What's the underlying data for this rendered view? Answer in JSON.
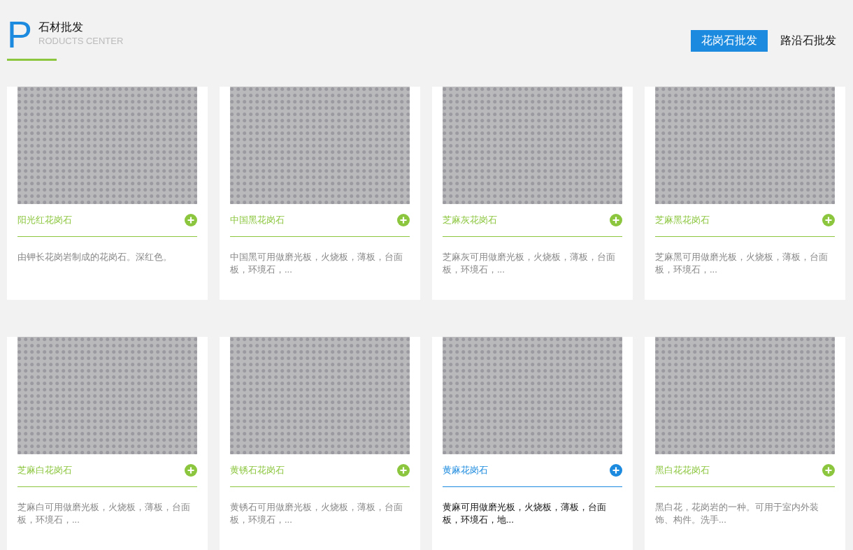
{
  "header": {
    "initial": "P",
    "title": "石材批发",
    "subtitle": "RODUCTS CENTER"
  },
  "tabs": [
    {
      "label": "花岗石批发",
      "selected": true
    },
    {
      "label": "路沿石批发",
      "selected": false
    }
  ],
  "products": [
    {
      "name": "阳光红花岗石",
      "description": "由钾长花岗岩制成的花岗石。深红色。",
      "highlighted": false
    },
    {
      "name": "中国黑花岗石",
      "description": "中国黑可用做磨光板，火烧板，薄板，台面板，环境石，...",
      "highlighted": false
    },
    {
      "name": "芝麻灰花岗石",
      "description": "芝麻灰可用做磨光板，火烧板，薄板，台面板，环境石，...",
      "highlighted": false
    },
    {
      "name": "芝麻黑花岗石",
      "description": "芝麻黑可用做磨光板，火烧板，薄板，台面板，环境石，...",
      "highlighted": false
    },
    {
      "name": "芝麻白花岗石",
      "description": "芝麻白可用做磨光板，火烧板，薄板，台面板，环境石，...",
      "highlighted": false
    },
    {
      "name": "黄锈石花岗石",
      "description": "黄锈石可用做磨光板，火烧板，薄板，台面板，环境石，...",
      "highlighted": false
    },
    {
      "name": "黄麻花岗石",
      "description": "黄麻可用做磨光板，火烧板，薄板，台面板，环境石，地...",
      "highlighted": true
    },
    {
      "name": "黑白花花岗石",
      "description": "黑白花，花岗岩的一种。可用于室内外装饰、构件。洗手...",
      "highlighted": false
    }
  ]
}
